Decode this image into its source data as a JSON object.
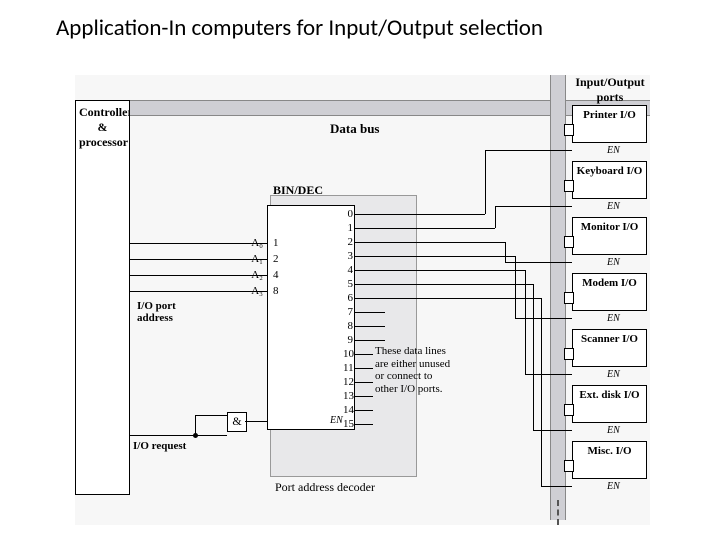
{
  "title": "Application-In computers for Input/Output selection",
  "header": {
    "io_ports": "Input/Output\nports",
    "data_bus": "Data bus"
  },
  "cpu": {
    "label": "Controller & processor"
  },
  "decoder": {
    "title": "BIN/DEC",
    "caption": "Port address decoder",
    "en_label": "EN",
    "inputs": [
      {
        "addr": "A0",
        "addr_rendered": "A₀",
        "weight": "1"
      },
      {
        "addr": "A1",
        "addr_rendered": "A₁",
        "weight": "2"
      },
      {
        "addr": "A2",
        "addr_rendered": "A₂",
        "weight": "4"
      },
      {
        "addr": "A3",
        "addr_rendered": "A₃",
        "weight": "8"
      }
    ],
    "outputs": [
      "0",
      "1",
      "2",
      "3",
      "4",
      "5",
      "6",
      "7",
      "8",
      "9",
      "10",
      "11",
      "12",
      "13",
      "14",
      "15"
    ]
  },
  "note": "These data lines are either unused or connect to other I/O ports.",
  "signals": {
    "io_port_address": "I/O port address",
    "io_request": "I/O request",
    "and_gate": "&"
  },
  "io_devices": [
    {
      "name": "Printer I/O",
      "en": "EN"
    },
    {
      "name": "Keyboard I/O",
      "en": "EN"
    },
    {
      "name": "Monitor I/O",
      "en": "EN"
    },
    {
      "name": "Modem I/O",
      "en": "EN"
    },
    {
      "name": "Scanner I/O",
      "en": "EN"
    },
    {
      "name": "Ext. disk I/O",
      "en": "EN"
    },
    {
      "name": "Misc. I/O",
      "en": "EN"
    }
  ]
}
